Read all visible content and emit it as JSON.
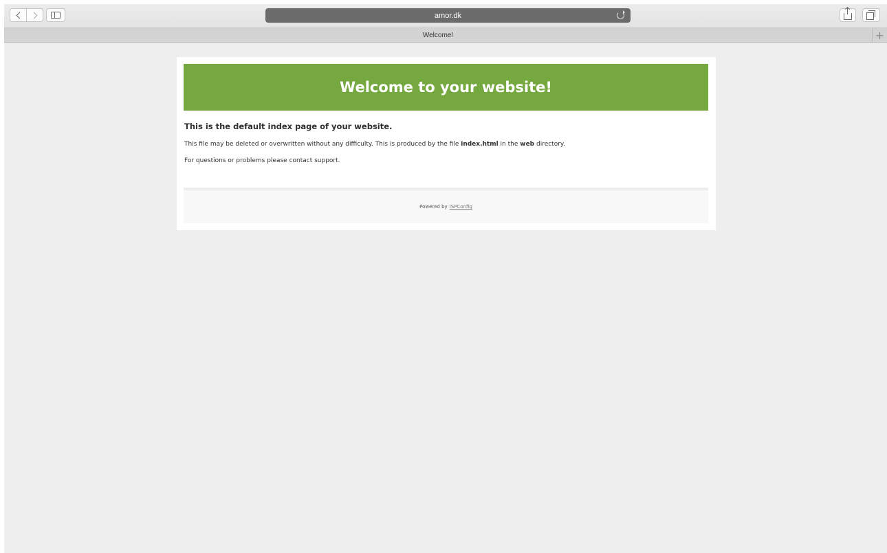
{
  "browser": {
    "address": "amor.dk",
    "tab_title": "Welcome!",
    "new_tab_symbol": "+"
  },
  "page": {
    "banner_title": "Welcome to your website!",
    "lead": "This is the default index page of your website.",
    "paragraph1": {
      "before_file": "This file may be deleted or overwritten without any difficulty. This is produced by the file ",
      "file": "index.html",
      "before_dir": " in the ",
      "dir": "web",
      "after_dir": " directory."
    },
    "paragraph2": "For questions or problems please contact support.",
    "footer": {
      "prefix": "Powered by",
      "link": "ISPConfig"
    }
  },
  "colors": {
    "banner": "#76a840",
    "background": "#eeeeee",
    "address_bar": "#6b6b6b"
  }
}
